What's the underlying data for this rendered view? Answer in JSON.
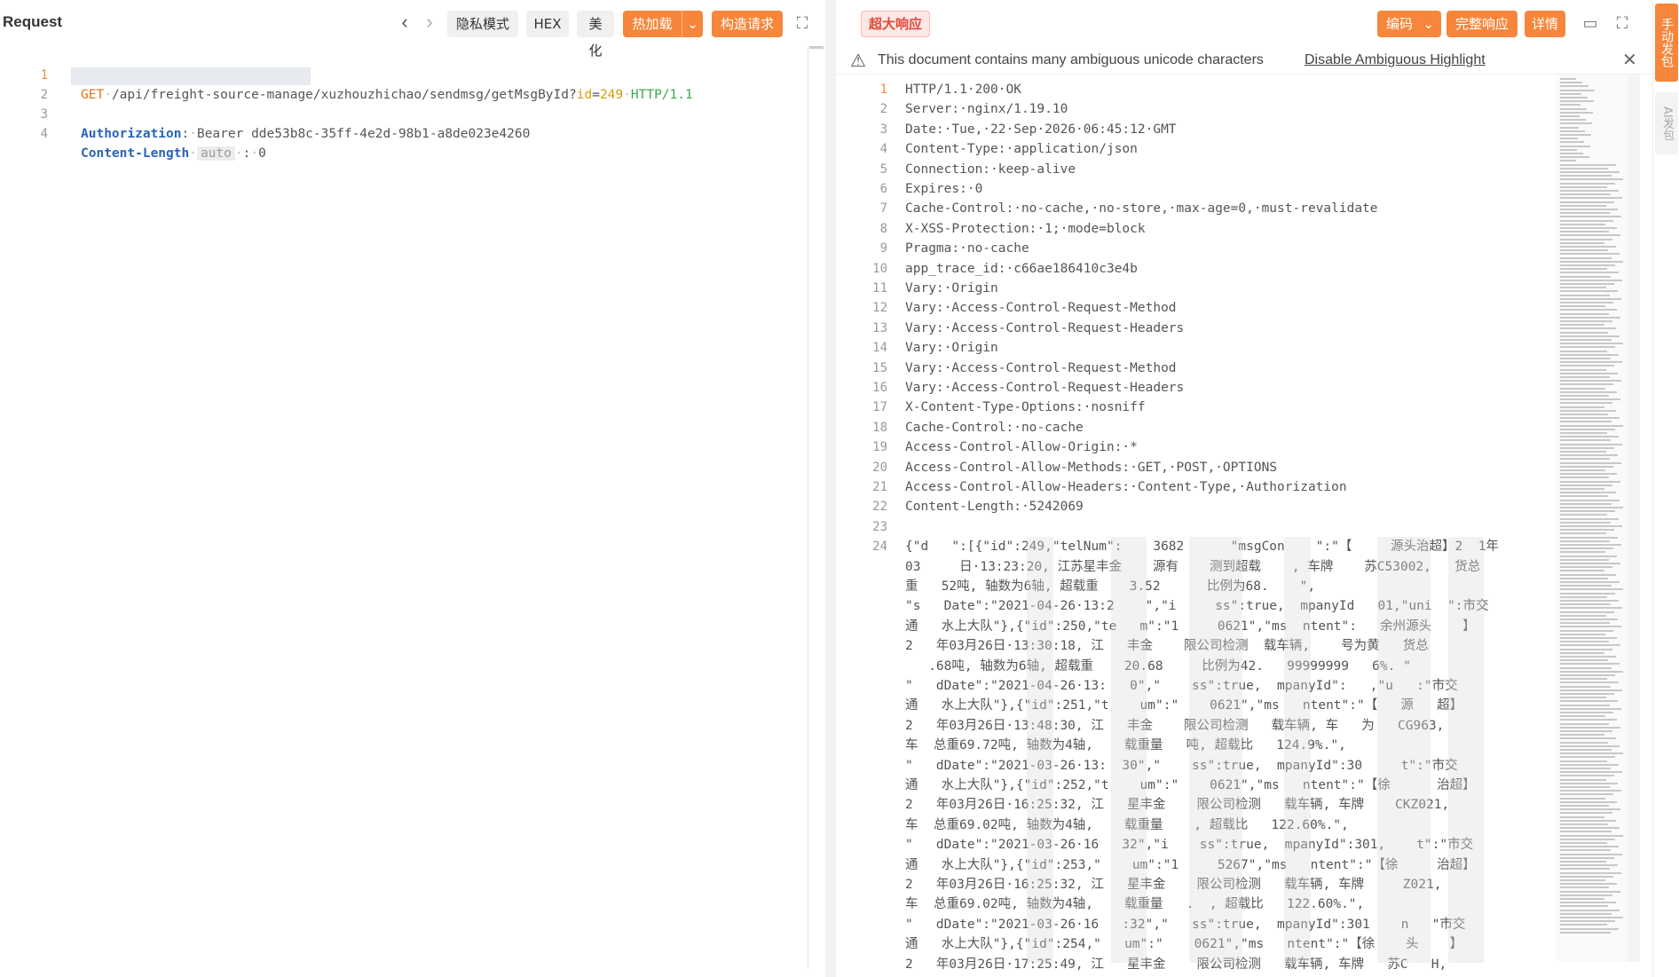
{
  "request": {
    "title": "Request",
    "toolbar": {
      "private_mode": "隐私模式",
      "hex": "HEX",
      "beautify": "美化",
      "hot_load": "热加载",
      "build_request": "构造请求"
    },
    "lines": [
      {
        "n": "1",
        "method": "GET",
        "path": "/api/freight-source-manage/xuzhouzhichao/sendmsg/getMsgById?",
        "param_key": "id",
        "param_eq": "=",
        "param_val": "249",
        "proto": "HTTP/1.1"
      },
      {
        "n": "2"
      },
      {
        "n": "3",
        "header": "Authorization",
        "value": "Bearer dde53b8c-35ff-4e2d-98b1-a8de023e4260"
      },
      {
        "n": "4",
        "header": "Content-Length",
        "hint": "auto",
        "value": "0"
      }
    ]
  },
  "response": {
    "toolbar": {
      "big_response": "超大响应",
      "encoding": "编码",
      "full_response": "完整响应",
      "details": "详情"
    },
    "warning": {
      "text": "This document contains many ambiguous unicode characters",
      "link": "Disable Ambiguous Highlight"
    },
    "lines": [
      "HTTP/1.1·200·OK",
      "Server:·nginx/1.19.10",
      "Date:·Tue,·22·Sep·2026·06:45:12·GMT",
      "Content-Type:·application/json",
      "Connection:·keep-alive",
      "Expires:·0",
      "Cache-Control:·no-cache,·no-store,·max-age=0,·must-revalidate",
      "X-XSS-Protection:·1;·mode=block",
      "Pragma:·no-cache",
      "app_trace_id:·c66ae186410c3e4b",
      "Vary:·Origin",
      "Vary:·Access-Control-Request-Method",
      "Vary:·Access-Control-Request-Headers",
      "Vary:·Origin",
      "Vary:·Access-Control-Request-Method",
      "Vary:·Access-Control-Request-Headers",
      "X-Content-Type-Options:·nosniff",
      "Cache-Control:·no-cache",
      "Access-Control-Allow-Origin:·*",
      "Access-Control-Allow-Methods:·GET,·POST,·OPTIONS",
      "Access-Control-Allow-Headers:·Content-Type,·Authorization",
      "Content-Length:·5242069",
      ""
    ],
    "body_line_number": "24",
    "body_lines": [
      "{\"d   \":[{\"id\":249,\"telNum\":    3682      \"msgCon    \":\"【     源头治超】2  1年",
      "03     日·13:23:20, 江苏星丰金    源有    测到超载    , 车牌    苏C53002,   货总",
      "重   52吨, 轴数为6轴, 超载重    3.52      比例为68.    \",",
      "\"s   Date\":\"2021-04-26·13:2    \",\"i     ss\":true,  mpanyId   01,\"uni  \":市交",
      "通   水上大队\"},{\"id\":250,\"te   m\":\"1     0621\",\"ms  ntent\":   余州源头    】",
      "2   年03月26日·13:30:18, 江   丰金    限公司检测  载车辆,    号为黄   货总",
      "   .68吨, 轴数为6轴, 超载重    20.68     比例为42.   99999999   6%. \"",
      "\"   dDate\":\"2021-04-26·13:   0\",\"    ss\":true,  mpanyId\":   ,\"u   :\"市交",
      "通   水上大队\"},{\"id\":251,\"t    um\":\"    0621\",\"ms   ntent\":\"【   源   超】",
      "2   年03月26日·13:48:30, 江   丰金    限公司检测   载车辆, 车   为   CG963,",
      "车  总重69.72吨, 轴数为4轴,    载重量   吨, 超载比   124.9%.\",",
      "\"   dDate\":\"2021-03-26·13:  30\",\"    ss\":true,  mpanyId\":30     t\":\"市交",
      "通   水上大队\"},{\"id\":252,\"t    um\":\"    0621\",\"ms   ntent\":\"【徐      治超】",
      "2   年03月26日·16:25:32, 江   星丰金    限公司检测   载车辆, 车牌    CKZ021,",
      "车  总重69.02吨, 轴数为4轴,    载重量    , 超载比   122.60%.\",",
      "\"   dDate\":\"2021-03-26·16   32\",\"i    ss\":true,  mpanyId\":301,    t\":\"市交",
      "通   水上大队\"},{\"id\":253,\"    um\":\"1     5267\",\"ms   ntent\":\"【徐     治超】",
      "2   年03月26日·16:25:32, 江   星丰金    限公司检测   载车辆, 车牌     Z021,",
      "车  总重69.02吨, 轴数为4轴,    载重量   .  , 超载比   122.60%.\",",
      "\"   dDate\":\"2021-03-26·16   :32\",\"   ss\":true,  mpanyId\":301    n   \"市交",
      "通   水上大队\"},{\"id\":254,\"   um\":\"    0621\",\"ms   ntent\":\"【徐    头    】",
      "2   年03月26日·17:25:49, 江   星丰金    限公司检测   载车辆, 车牌   苏C   H,"
    ]
  },
  "side": {
    "manual": "手动发包",
    "ai": "AI发包"
  }
}
